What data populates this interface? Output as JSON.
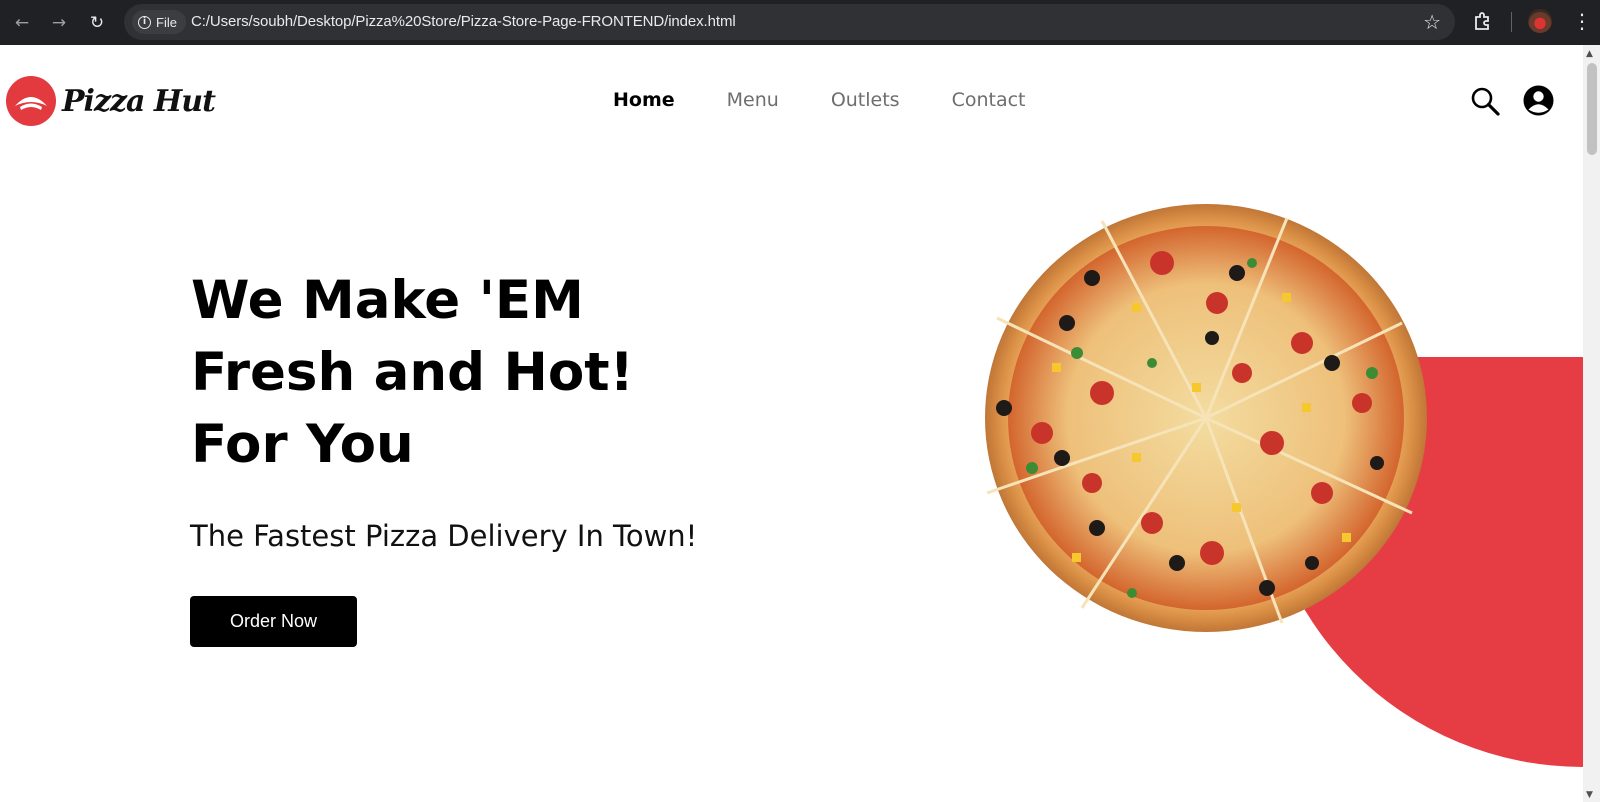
{
  "browser": {
    "file_chip": "File",
    "url": "C:/Users/soubh/Desktop/Pizza%20Store/Pizza-Store-Page-FRONTEND/index.html"
  },
  "brand": {
    "logo_text": "Pizza Hut",
    "accent_color": "#e63d45"
  },
  "nav": {
    "items": [
      {
        "label": "Home",
        "active": true
      },
      {
        "label": "Menu",
        "active": false
      },
      {
        "label": "Outlets",
        "active": false
      },
      {
        "label": "Contact",
        "active": false
      }
    ]
  },
  "header_icons": [
    "search-icon",
    "user-account-icon"
  ],
  "hero": {
    "title_lines": [
      "We Make 'EM",
      "Fresh and Hot!",
      "For You"
    ],
    "subtitle": "The Fastest Pizza Delivery In Town!",
    "cta_label": "Order Now"
  }
}
